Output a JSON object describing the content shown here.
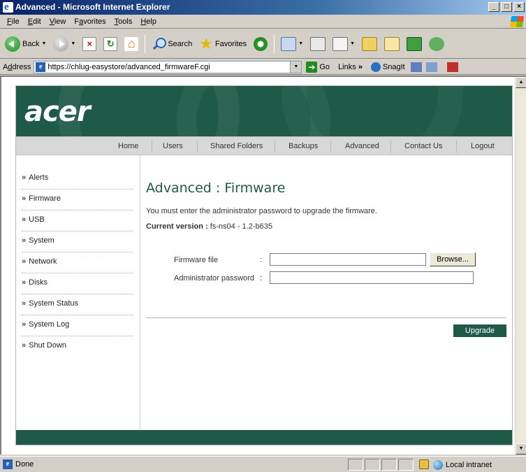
{
  "window": {
    "title": "Advanced - Microsoft Internet Explorer",
    "min": "_",
    "max": "□",
    "close": "×"
  },
  "menu": {
    "file_u": "F",
    "file": "ile",
    "edit_u": "E",
    "edit": "dit",
    "view_u": "V",
    "view": "iew",
    "fav_pre": "F",
    "fav_u": "a",
    "fav": "vorites",
    "tools_u": "T",
    "tools": "ools",
    "help_u": "H",
    "help": "elp"
  },
  "toolbar": {
    "back": "Back",
    "search": "Search",
    "favorites": "Favorites"
  },
  "address": {
    "label_pre": "A",
    "label_u": "d",
    "label": "dress",
    "url": "https://chlug-easystore/advanced_firmwareF.cgi",
    "go": "Go",
    "links": "Links",
    "links_more": "»",
    "snagit": "SnagIt"
  },
  "site": {
    "logo": "acer",
    "nav": [
      "Home",
      "Users",
      "Shared Folders",
      "Backups",
      "Advanced",
      "Contact Us",
      "Logout"
    ],
    "sidebar": [
      "Alerts",
      "Firmware",
      "USB",
      "System",
      "Network",
      "Disks",
      "System Status",
      "System Log",
      "Shut Down"
    ],
    "bullet": "»"
  },
  "content": {
    "title": "Advanced : Firmware",
    "description": "You must enter the administrator password to upgrade the firmware.",
    "version_label": "Current version :",
    "version_value": "fs-ns04 - 1.2-b635",
    "firmware_label": "Firmware file",
    "password_label": "Administrator password",
    "colon": ":",
    "firmware_value": "",
    "password_value": "",
    "browse": "Browse...",
    "upgrade": "Upgrade"
  },
  "status": {
    "text": "Done",
    "zone": "Local intranet"
  },
  "colors": {
    "brand": "#1f5a48"
  }
}
